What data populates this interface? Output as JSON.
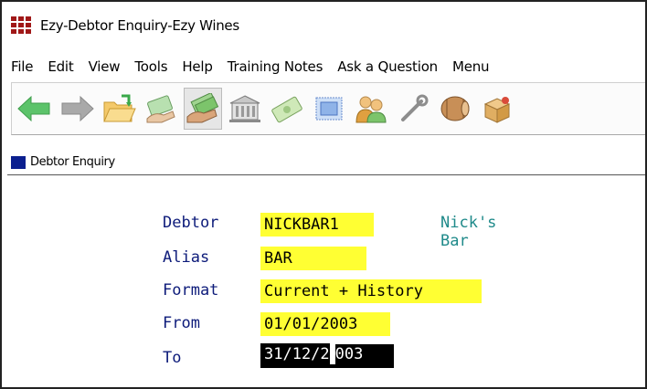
{
  "window": {
    "title": "Ezy-Debtor Enquiry-Ezy Wines"
  },
  "menu": [
    "File",
    "Edit",
    "View",
    "Tools",
    "Help",
    "Training Notes",
    "Ask a Question",
    "Menu"
  ],
  "toolbar": {
    "buttons": [
      {
        "icon": "back-arrow-icon"
      },
      {
        "icon": "forward-arrow-icon"
      },
      {
        "icon": "open-folder-icon"
      },
      {
        "icon": "payment-icon"
      },
      {
        "icon": "money-hand-icon"
      },
      {
        "icon": "bank-icon"
      },
      {
        "icon": "banknote-icon"
      },
      {
        "icon": "stamp-icon"
      },
      {
        "icon": "people-icon"
      },
      {
        "icon": "wrench-icon"
      },
      {
        "icon": "barrel-icon"
      },
      {
        "icon": "box-icon"
      }
    ]
  },
  "panel": {
    "title": "Debtor Enquiry"
  },
  "form": {
    "debtor_label": "Debtor",
    "debtor_value": "NICKBAR1",
    "debtor_name": "Nick's Bar",
    "alias_label": "Alias",
    "alias_value": "BAR",
    "format_label": "Format",
    "format_value": "Current + History",
    "from_label": "From",
    "from_value": "01/01/2003",
    "to_label": "To",
    "to_value_before_cursor": "31/12/2",
    "to_value_after_cursor": "003"
  },
  "colors": {
    "field_highlight": "#ffff33",
    "label_color": "#0d1b7a",
    "name_color": "#1f8a8a",
    "panel_square": "#0b1f8f"
  }
}
